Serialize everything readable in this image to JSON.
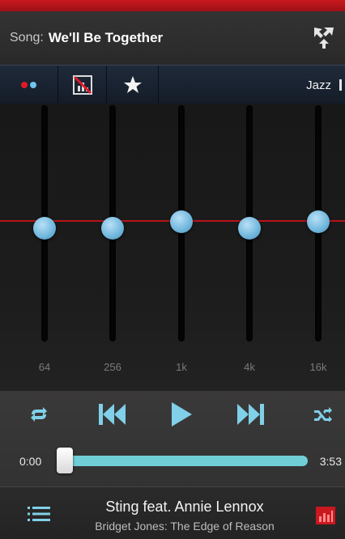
{
  "song_bar": {
    "label": "Song:",
    "title": "We'll Be Together"
  },
  "toolbar": {
    "preset": "Jazz"
  },
  "equalizer": {
    "bands": [
      {
        "label": "64",
        "level": 0.43
      },
      {
        "label": "256",
        "level": 0.43
      },
      {
        "label": "1k",
        "level": 0.46
      },
      {
        "label": "4k",
        "level": 0.43
      },
      {
        "label": "16k",
        "level": 0.46
      }
    ]
  },
  "player": {
    "elapsed": "0:00",
    "duration": "3:53",
    "progress": 0.0
  },
  "now_playing": {
    "artist": "Sting feat. Annie Lennox",
    "album": "Bridget Jones: The Edge of Reason"
  },
  "colors": {
    "accent": "#c9181f",
    "slider_knob": "#6fb6dc",
    "progress": "#70cfd6",
    "toolbar": "#1f2a3a"
  },
  "icons": [
    "share-icon",
    "dots-icon",
    "no-visualizer-icon",
    "star-icon",
    "repeat-icon",
    "previous-icon",
    "play-icon",
    "next-icon",
    "shuffle-icon",
    "list-icon",
    "equalizer-icon"
  ]
}
